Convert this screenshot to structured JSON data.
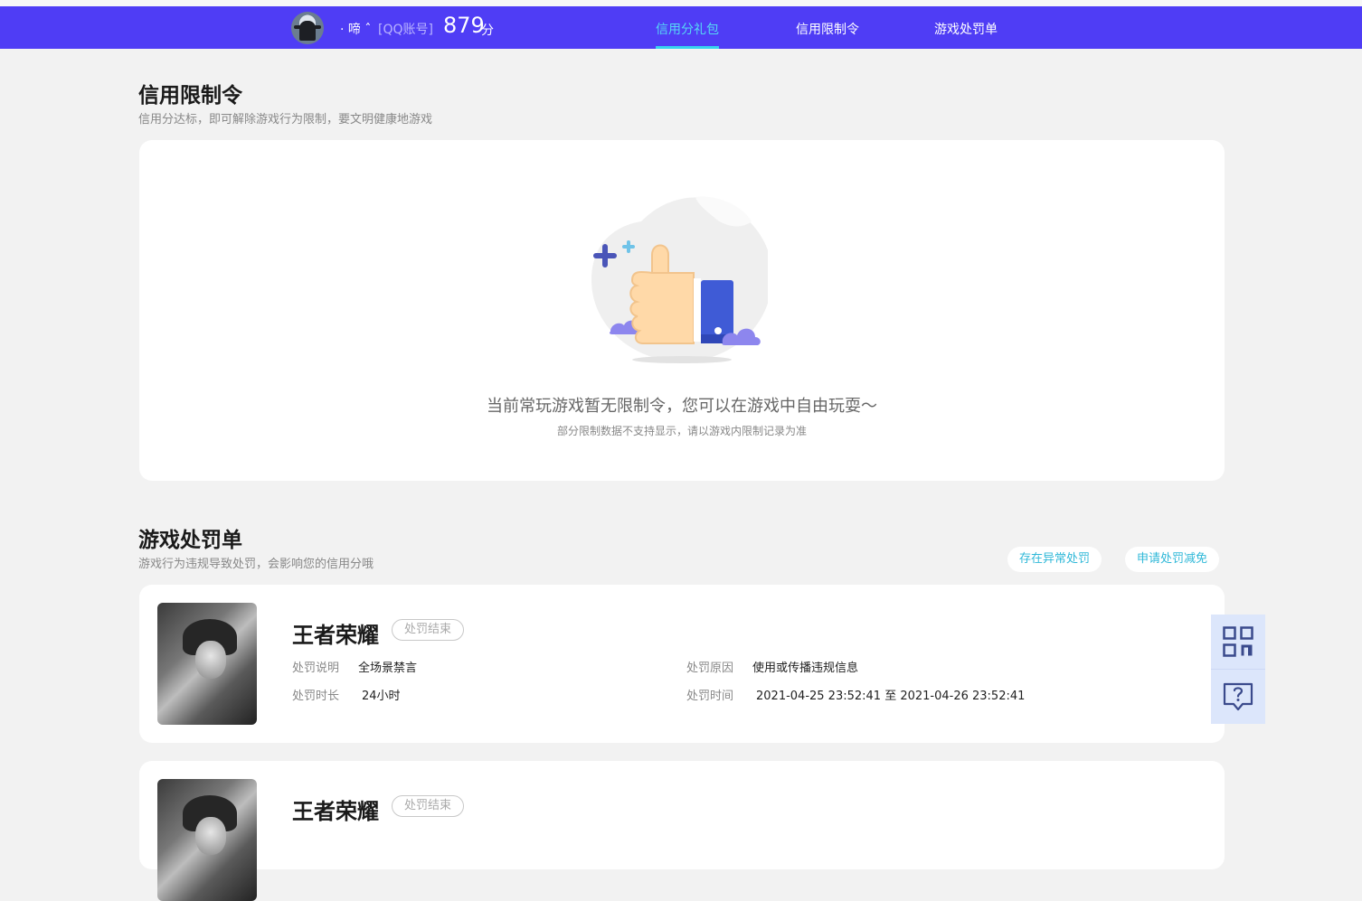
{
  "header": {
    "nickname": "· 啼 ˆ",
    "account_type": "[QQ账号]",
    "score": "879",
    "score_unit": "分",
    "tabs": [
      {
        "label": "信用分礼包",
        "active": true
      },
      {
        "label": "信用限制令",
        "active": false
      },
      {
        "label": "游戏处罚单",
        "active": false
      }
    ],
    "accent_color": "#4f3df5",
    "active_tab_color": "#56d8f5"
  },
  "restriction_section": {
    "title": "信用限制令",
    "subtitle": "信用分达标，即可解除游戏行为限制，要文明健康地游戏",
    "empty_message": "当前常玩游戏暂无限制令，您可以在游戏中自由玩耍～",
    "empty_note": "部分限制数据不支持显示，请以游戏内限制记录为准"
  },
  "penalty_section": {
    "title": "游戏处罚单",
    "subtitle": "游戏行为违规导致处罚，会影响您的信用分哦",
    "actions": [
      "存在异常处罚",
      "申请处罚减免"
    ],
    "records": [
      {
        "game": "王者荣耀",
        "status": "处罚结束",
        "desc_label": "处罚说明",
        "desc_value": "全场景禁言",
        "duration_label": "处罚时长",
        "duration_value": "24小时",
        "reason_label": "处罚原因",
        "reason_value": "使用或传播违规信息",
        "time_label": "处罚时间",
        "time_value": "2021-04-25 23:52:41 至 2021-04-26 23:52:41"
      },
      {
        "game": "王者荣耀",
        "status": "处罚结束"
      }
    ]
  },
  "float_buttons": [
    "qr-code-icon",
    "help-icon"
  ]
}
